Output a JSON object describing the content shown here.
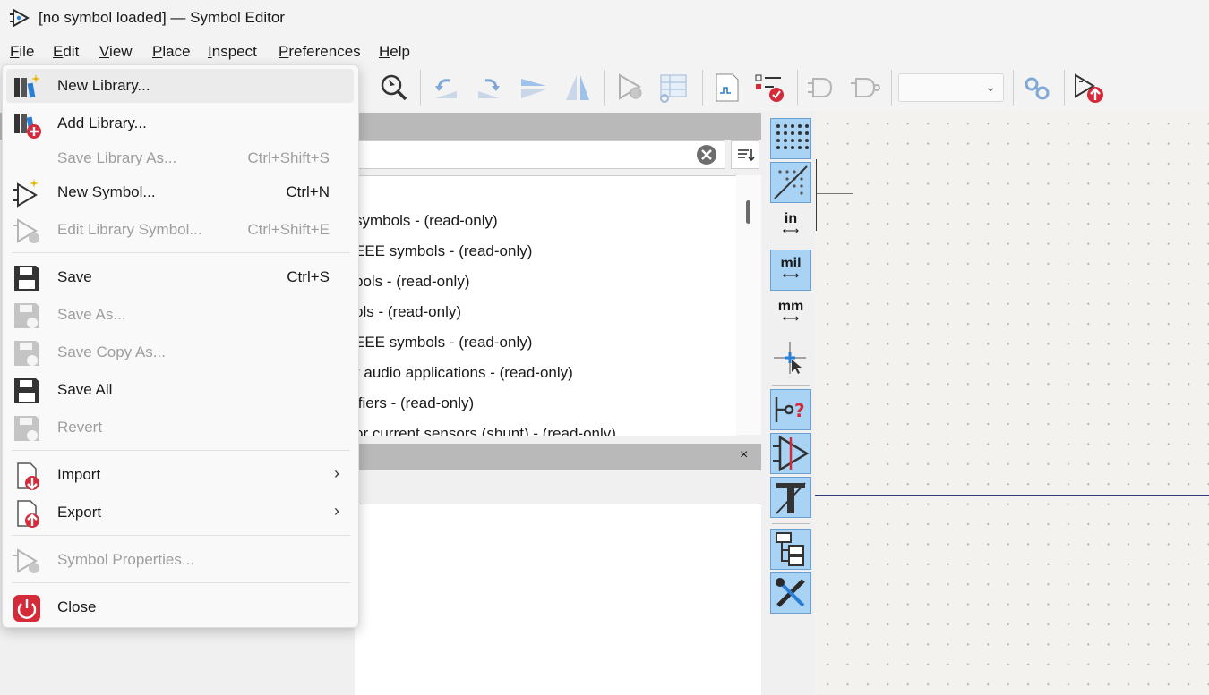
{
  "window": {
    "title": "[no symbol loaded] — Symbol Editor"
  },
  "menubar": [
    {
      "label": "File",
      "key": "F",
      "rest": "ile"
    },
    {
      "label": "Edit",
      "key": "E",
      "rest": "dit"
    },
    {
      "label": "View",
      "key": "V",
      "rest": "iew"
    },
    {
      "label": "Place",
      "key": "P",
      "rest": "lace"
    },
    {
      "label": "Inspect",
      "key": "I",
      "rest": "nspect"
    },
    {
      "label": "Preferences",
      "key": "P",
      "rest": "references"
    },
    {
      "label": "Help",
      "key": "H",
      "rest": "elp"
    }
  ],
  "file_menu": {
    "items": [
      {
        "label": "New Library...",
        "shortcut": "",
        "icon": "new-library-icon",
        "enabled": true
      },
      {
        "label": "Add Library...",
        "shortcut": "",
        "icon": "add-library-icon",
        "enabled": true
      },
      {
        "label": "Save Library As...",
        "shortcut": "Ctrl+Shift+S",
        "icon": "",
        "enabled": false
      },
      {
        "label": "New Symbol...",
        "shortcut": "Ctrl+N",
        "icon": "new-symbol-icon",
        "enabled": true
      },
      {
        "label": "Edit Library Symbol...",
        "shortcut": "Ctrl+Shift+E",
        "icon": "edit-symbol-icon",
        "enabled": false
      },
      {
        "label": "Save",
        "shortcut": "Ctrl+S",
        "icon": "save-icon",
        "enabled": true
      },
      {
        "label": "Save As...",
        "shortcut": "",
        "icon": "save-as-icon",
        "enabled": false
      },
      {
        "label": "Save Copy As...",
        "shortcut": "",
        "icon": "save-copy-icon",
        "enabled": false
      },
      {
        "label": "Save All",
        "shortcut": "",
        "icon": "save-all-icon",
        "enabled": true
      },
      {
        "label": "Revert",
        "shortcut": "",
        "icon": "revert-icon",
        "enabled": false
      },
      {
        "label": "Import",
        "shortcut": "",
        "icon": "import-icon",
        "enabled": true
      },
      {
        "label": "Export",
        "shortcut": "",
        "icon": "export-icon",
        "enabled": true
      },
      {
        "label": "Symbol Properties...",
        "shortcut": "",
        "icon": "symbol-properties-icon",
        "enabled": false
      },
      {
        "label": "Close",
        "shortcut": "",
        "icon": "close-power-icon",
        "enabled": true
      }
    ]
  },
  "library_list": {
    "rows": [
      "symbols - (read-only)",
      "EEE symbols - (read-only)",
      "bols - (read-only)",
      "ols - (read-only)",
      "EEE symbols - (read-only)",
      "r audio applications - (read-only)",
      "ifiers - (read-only)",
      "or current sensors (shunt) - (read-only)"
    ]
  },
  "details_panel": {
    "close_label": "×"
  },
  "left_tools": {
    "units_in": "in",
    "units_mil": "mil",
    "units_mm": "mm"
  },
  "colors": {
    "highlight": "#a9d3f5",
    "accent_red": "#d42a3a",
    "accent_blue": "#2a7fd4"
  }
}
